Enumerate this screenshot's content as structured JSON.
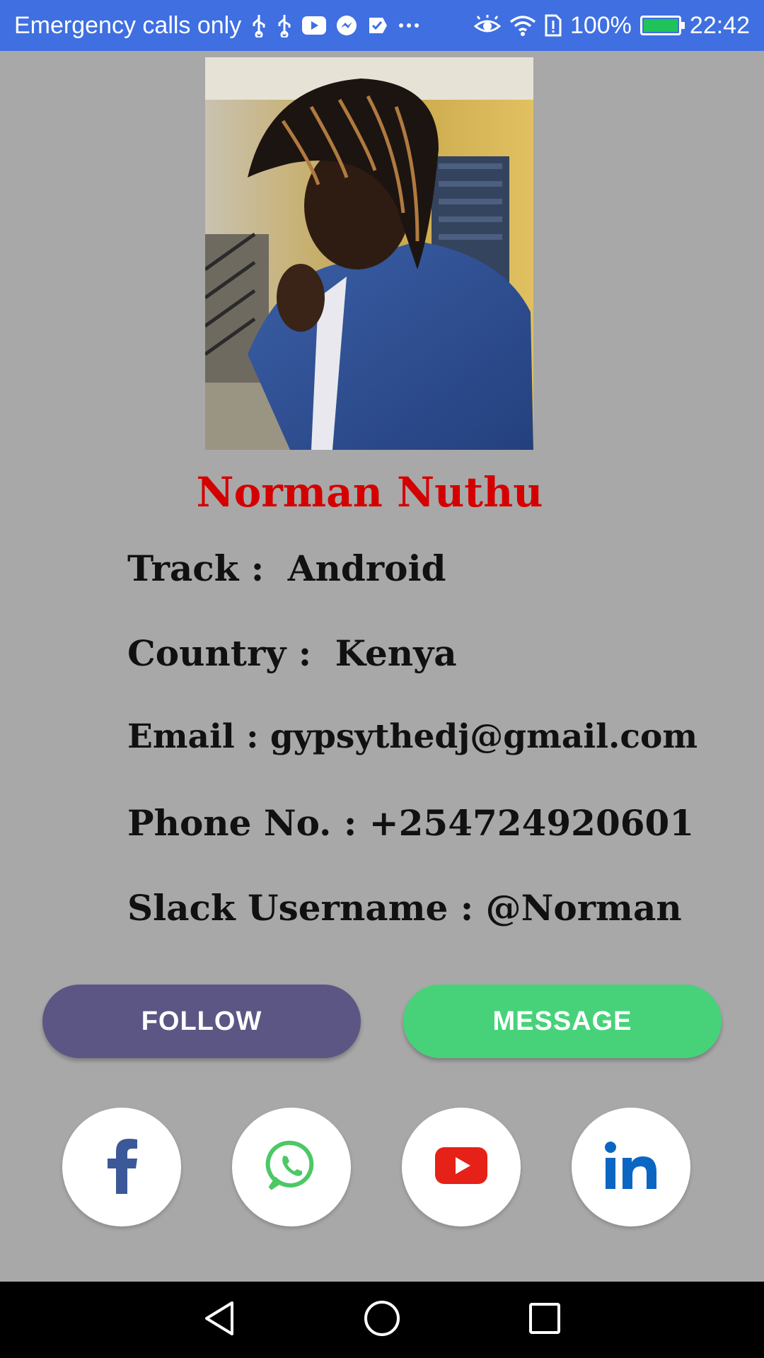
{
  "status_bar": {
    "carrier_text": "Emergency calls only",
    "battery_percent": "100%",
    "battery_level": 1.0,
    "time": "22:42",
    "icons_left": [
      "usb-icon",
      "usb-icon",
      "youtube-icon",
      "messenger-icon",
      "task-icon",
      "more-icon"
    ],
    "icons_right": [
      "eye-icon",
      "wifi-icon",
      "sim-alert-icon",
      "battery-icon"
    ]
  },
  "profile": {
    "name": "Norman Nuthu",
    "photo_alt": "profile-photo",
    "fields": {
      "track": {
        "label": "Track :",
        "value": "Android"
      },
      "country": {
        "label": "Country :",
        "value": "Kenya"
      },
      "email": {
        "label": "Email :",
        "value": "gypsythedj@gmail.com"
      },
      "phone": {
        "label": "Phone No. :",
        "value": "+254724920601"
      },
      "slack": {
        "label": "Slack Username :",
        "value": "@Norman"
      }
    }
  },
  "actions": {
    "follow_label": "FOLLOW",
    "message_label": "MESSAGE"
  },
  "social": [
    "facebook-icon",
    "whatsapp-icon",
    "youtube-icon",
    "linkedin-icon"
  ],
  "colors": {
    "status_bar": "#3f6fe0",
    "background": "#a8a8a8",
    "name": "#d40000",
    "follow": "#5c5684",
    "message": "#47d27a",
    "facebook": "#3b5998",
    "whatsapp": "#4cc864",
    "youtube": "#e62117",
    "linkedin": "#0a66c2"
  }
}
